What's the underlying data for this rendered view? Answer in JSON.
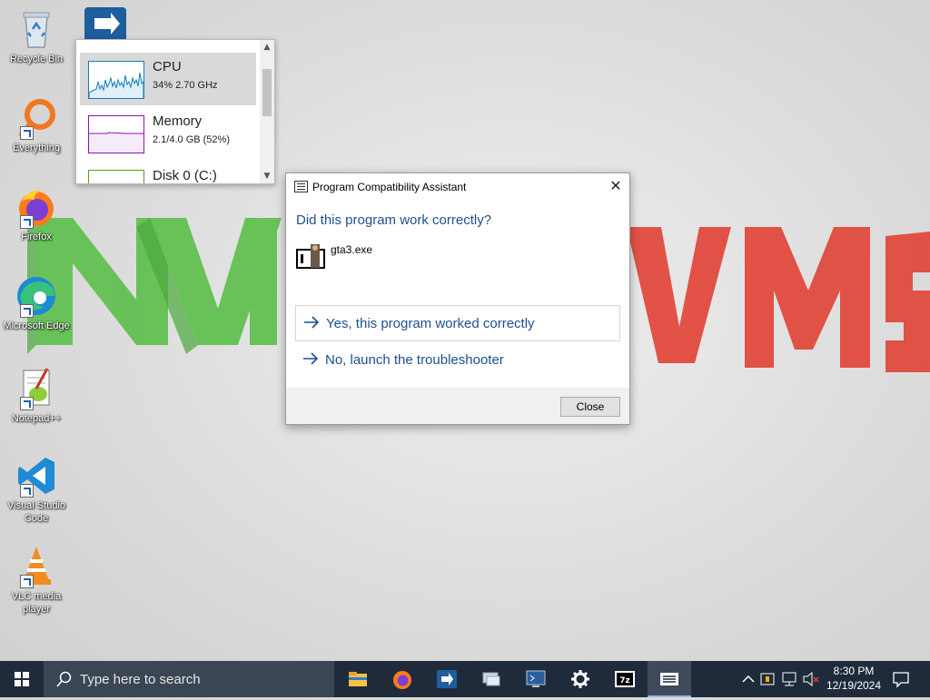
{
  "desktop": {
    "icons": [
      {
        "label": "Recycle Bin"
      },
      {
        "label": "Everything"
      },
      {
        "label": "Firefox"
      },
      {
        "label": "Microsoft Edge"
      },
      {
        "label": "Notepad++"
      },
      {
        "label": "Visual Studio Code"
      },
      {
        "label": "VLC media player"
      }
    ]
  },
  "perf_flyout": {
    "items": [
      {
        "title": "CPU",
        "sub": "34%  2.70 GHz",
        "graph_color": "#117dbb"
      },
      {
        "title": "Memory",
        "sub": "2.1/4.0 GB (52%)",
        "graph_color": "#8b12ae"
      },
      {
        "title": "Disk 0 (C:)",
        "sub": "",
        "graph_color": "#4da60c"
      }
    ]
  },
  "dialog": {
    "title": "Program Compatibility Assistant",
    "heading": "Did this program work correctly?",
    "program_name": "gta3.exe",
    "option_yes": "Yes, this program worked correctly",
    "option_no": "No, launch the troubleshooter",
    "close_button": "Close"
  },
  "taskbar": {
    "search_placeholder": "Type here to search",
    "apps": [
      "file-explorer-icon",
      "firefox-icon",
      "app-icon",
      "network-icon",
      "terminal-icon",
      "settings-icon",
      "7zip-icon",
      "compat-assistant-icon"
    ],
    "clock_time": "8:30 PM",
    "clock_date": "12/19/2024"
  },
  "colors": {
    "accent": "#1d4f91",
    "taskbar": "#1f2b3a"
  }
}
